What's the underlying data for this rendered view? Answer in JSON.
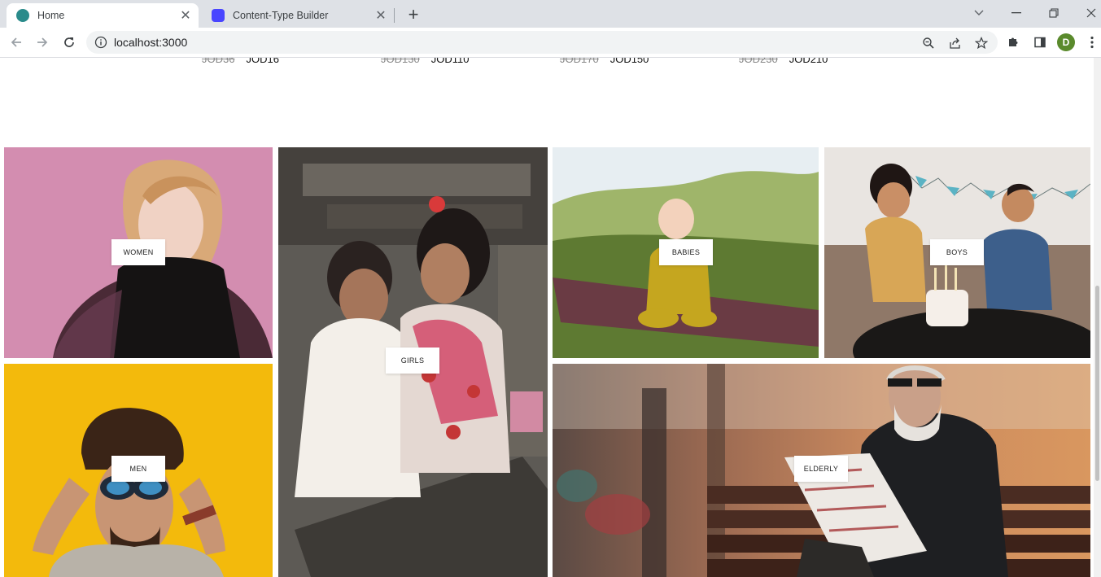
{
  "browser": {
    "tabs": [
      {
        "title": "Home",
        "active": true
      },
      {
        "title": "Content-Type Builder",
        "active": false
      }
    ],
    "url": "localhost:3000",
    "profile_initial": "D"
  },
  "prices": [
    {
      "old": "JOD36",
      "new": "JOD16"
    },
    {
      "old": "JOD130",
      "new": "JOD110"
    },
    {
      "old": "JOD170",
      "new": "JOD150"
    },
    {
      "old": "JOD230",
      "new": "JOD210"
    }
  ],
  "categories": {
    "women": "WOMEN",
    "girls": "GIRLS",
    "babies": "BABIES",
    "boys": "BOYS",
    "men": "MEN",
    "elderly": "ELDERLY"
  },
  "colors": {
    "women_bg": "#d38db0",
    "men_bg": "#f5be0e",
    "accent_tab_icon": "#4945ff",
    "home_tab_icon": "#2a8b8b"
  }
}
